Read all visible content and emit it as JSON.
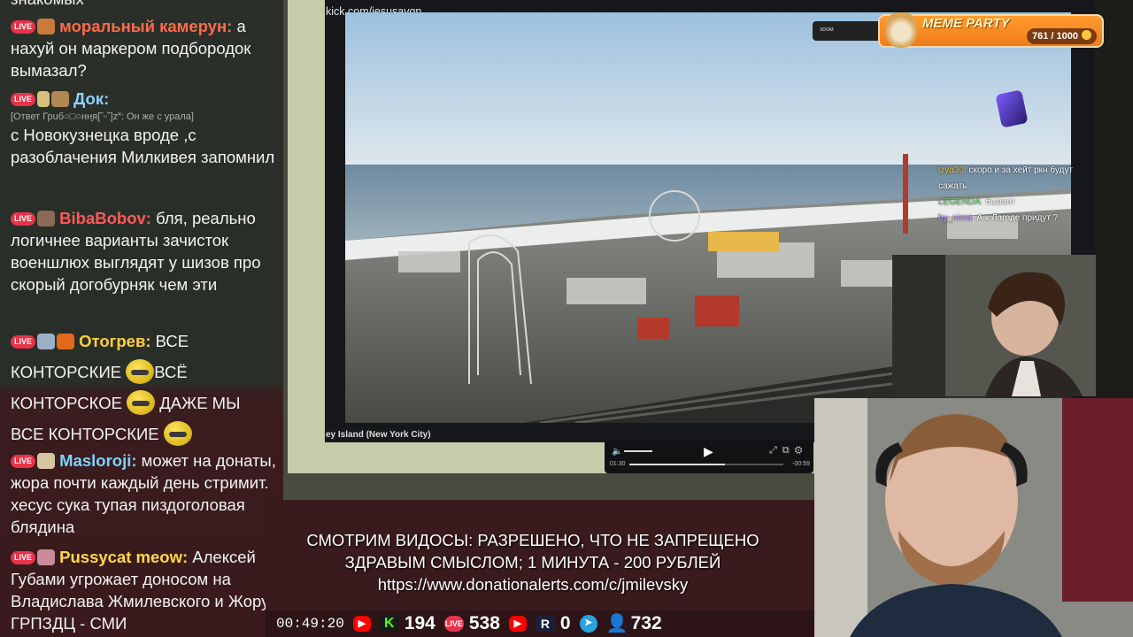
{
  "chat": {
    "top_fragment": "знакомых",
    "messages": [
      {
        "nick": "моральный камерун:",
        "nick_color": "#ff6b4a",
        "text": " а нахуй он маркером подбородок вымазал?"
      },
      {
        "nick": "Док:",
        "nick_color": "#8fd1ff",
        "reply": "[Ответ Грuб○□○нн͍я[˘ᵕ˘]z˟: Он же с урала]",
        "text": "с Новокузнецка вроде ,с разоблачения Милкивея запомнил"
      },
      {
        "nick": "BibaBobov:",
        "nick_color": "#ff5a5a",
        "text": " бля, реально логичнее варианты зачисток военшлюх выглядят у шизов про скорый догобурняк чем эти"
      },
      {
        "nick": "Отогрев:",
        "nick_color": "#ffcf3a",
        "text_parts": [
          " ВСЕ КОНТОРСКИЕ ",
          "ВСЁ КОНТОРСКОЕ ",
          " ДАЖЕ МЫ ВСЕ КОНТОРСКИЕ "
        ]
      },
      {
        "nick": "Masloroji:",
        "nick_color": "#7ad3ff",
        "text": " может на донаты, жора почти каждый день стримит. хесус сука тупая пиздоголовая блядина"
      },
      {
        "nick": "Pussycat meow:",
        "nick_color": "#ffd84a",
        "text": " Алексей Губами угрожает доносом на Владислава Жмилевского и Жору ГРПЗДЦ - СМИ"
      }
    ],
    "live_badge": "LIVE"
  },
  "video": {
    "url": "kick.com/jesusavgn",
    "caption": "ey Island (New York City)",
    "time_left": "01:30",
    "time_right": "-00:59",
    "progress": 0.62
  },
  "meme_party": {
    "tag": "зоом",
    "title": "MEME PARTY",
    "counter": "761 / 1000"
  },
  "mini_chat": [
    {
      "nick": "izya30",
      "text": ": скоро и за хейт ркн будут сажать"
    },
    {
      "nick": "LEGENDA",
      "text": ": бывает"
    },
    {
      "nick": "by_nima",
      "text": ": А к Лагоде придут ?"
    }
  ],
  "announcement": {
    "line1": "СМОТРИМ ВИДОСЫ: РАЗРЕШЕНО, ЧТО НЕ ЗАПРЕЩЕНО",
    "line2": "ЗДРАВЫМ СМЫСЛОМ; 1 МИНУТА - 200 РУБЛЕЙ",
    "line3": "https://www.donationalerts.com/c/jmilevsky"
  },
  "statbar": {
    "timer": "00:49:20",
    "kick_count": "194",
    "live_count": "538",
    "rutube_count": "0",
    "total_count": "732",
    "kick_label": "K",
    "live_label": "LIVE",
    "r_label": "R"
  }
}
